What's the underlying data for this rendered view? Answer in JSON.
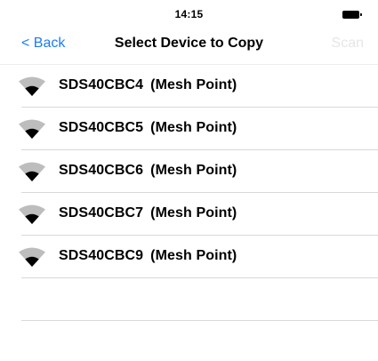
{
  "status_bar": {
    "time": "14:15",
    "battery_icon": "battery-full-icon"
  },
  "nav": {
    "back_label": "< Back",
    "title": "Select Device to Copy",
    "scan_label": "Scan",
    "back_color": "#1a7cf5",
    "scan_color": "#e6e6e6"
  },
  "devices": [
    {
      "id": "SDS40CBC4",
      "type": "(Mesh Point)",
      "icon": "wifi-signal-icon"
    },
    {
      "id": "SDS40CBC5",
      "type": "(Mesh Point)",
      "icon": "wifi-signal-icon"
    },
    {
      "id": "SDS40CBC6",
      "type": "(Mesh Point)",
      "icon": "wifi-signal-icon"
    },
    {
      "id": "SDS40CBC7",
      "type": "(Mesh Point)",
      "icon": "wifi-signal-icon"
    },
    {
      "id": "SDS40CBC9",
      "type": "(Mesh Point)",
      "icon": "wifi-signal-icon"
    }
  ]
}
